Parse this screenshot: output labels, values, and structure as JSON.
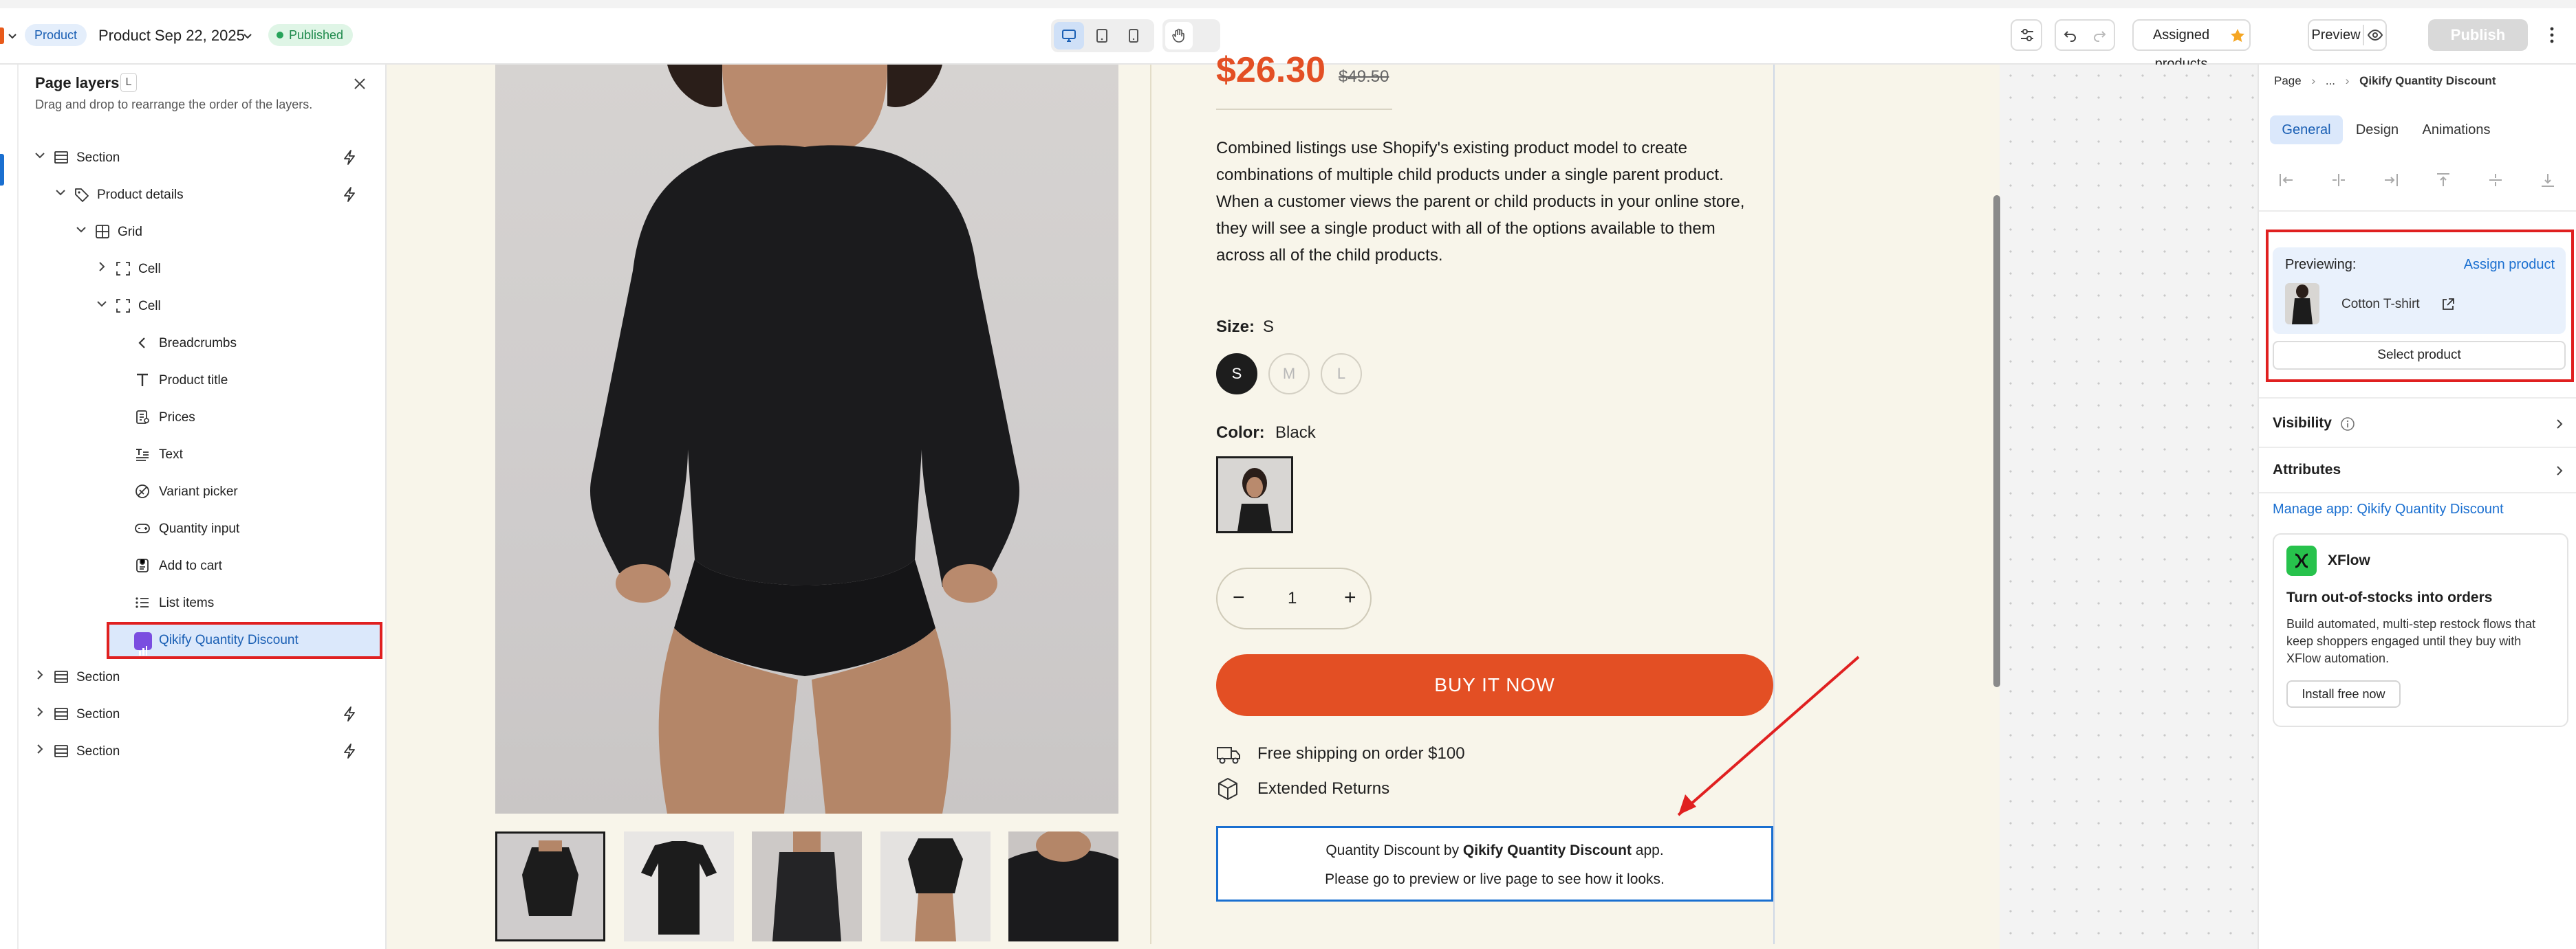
{
  "topbar": {
    "product_badge": "Product",
    "page_title": "Product Sep 22, 2025",
    "status": "Published",
    "assigned_products": "Assigned products",
    "preview": "Preview",
    "publish": "Publish"
  },
  "layers": {
    "title": "Page layers",
    "shortcut": "L",
    "subtitle": "Drag and drop to rearrange the order of the layers.",
    "items": [
      {
        "label": "Section",
        "icon": "section-icon"
      },
      {
        "label": "Product details",
        "icon": "tag-icon"
      },
      {
        "label": "Grid",
        "icon": "grid-icon"
      },
      {
        "label": "Cell",
        "icon": "cell-icon"
      },
      {
        "label": "Cell",
        "icon": "cell-icon"
      },
      {
        "label": "Breadcrumbs",
        "icon": "chevron-left-icon"
      },
      {
        "label": "Product title",
        "icon": "text-t-icon"
      },
      {
        "label": "Prices",
        "icon": "price-icon"
      },
      {
        "label": "Text",
        "icon": "text-block-icon"
      },
      {
        "label": "Variant picker",
        "icon": "variant-icon"
      },
      {
        "label": "Quantity input",
        "icon": "quantity-icon"
      },
      {
        "label": "Add to cart",
        "icon": "cart-icon"
      },
      {
        "label": "List items",
        "icon": "list-icon"
      },
      {
        "label": "Qikify Quantity Discount",
        "icon": "app-icon"
      },
      {
        "label": "Section",
        "icon": "section-icon"
      },
      {
        "label": "Section",
        "icon": "section-icon"
      },
      {
        "label": "Section",
        "icon": "section-icon"
      }
    ]
  },
  "product": {
    "price": "$26.30",
    "compare_price": "$49.50",
    "description": "Combined listings use Shopify's existing product model to create combinations of multiple child products under a single parent product. When a customer views the parent or child products in your online store, they will see a single product with all of the options available to them across all of the child products.",
    "size_label": "Size:",
    "size_value": "S",
    "sizes": [
      "S",
      "M",
      "L"
    ],
    "color_label": "Color:",
    "color_value": "Black",
    "quantity": "1",
    "buy_now": "BUY IT NOW",
    "shipping": "Free shipping on order $100",
    "returns": "Extended Returns",
    "discount_prefix": "Quantity Discount by",
    "discount_app": "Qikify Quantity Discount",
    "discount_suffix": "app.",
    "discount_note": "Please go to preview or live page to see how it looks."
  },
  "inspector": {
    "breadcrumb_page": "Page",
    "breadcrumb_more": "...",
    "breadcrumb_current": "Qikify Quantity Discount",
    "tabs": [
      "General",
      "Design",
      "Animations"
    ],
    "previewing_label": "Previewing:",
    "assign_product": "Assign product",
    "preview_product": "Cotton T-shirt",
    "select_product": "Select product",
    "visibility": "Visibility",
    "attributes": "Attributes",
    "manage_app": "Manage app: Qikify Quantity Discount",
    "promo_brand": "XFlow",
    "promo_title": "Turn out-of-stocks into orders",
    "promo_body": "Build automated, multi-step restock flows that keep shoppers engaged until they buy with XFlow automation.",
    "promo_cta": "Install free now"
  },
  "colors": {
    "accent_blue": "#1a6fd0",
    "buy_button": "#e34f24",
    "highlight_red": "#e02020",
    "page_bg": "#f8f5ea",
    "published_green": "#1e8a4c"
  }
}
